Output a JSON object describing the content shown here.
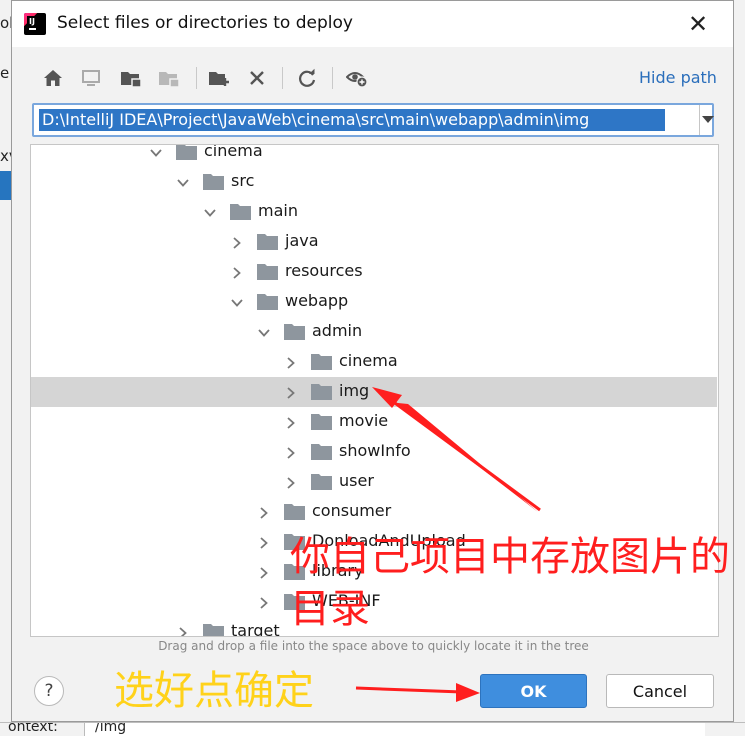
{
  "background": {
    "left_fragments": [
      "ol",
      "e",
      "xv"
    ],
    "bottom_left_text": "ontext:",
    "bottom_field_value": "/img"
  },
  "dialog": {
    "title": "Select files or directories to deploy",
    "app_icon": "intellij-idea-icon",
    "close_label": "✕"
  },
  "toolbar": {
    "icons": [
      "home-icon",
      "desktop-icon",
      "project-folder-icon",
      "module-folder-icon",
      "new-folder-icon",
      "delete-icon",
      "refresh-icon",
      "show-hidden-icon"
    ],
    "hide_path_label": "Hide path"
  },
  "path": {
    "value": "D:\\IntelliJ IDEA\\Project\\JavaWeb\\cinema\\src\\main\\webapp\\admin\\img"
  },
  "tree": {
    "rows": [
      {
        "label": "cinema",
        "depth": 0,
        "expanded": true
      },
      {
        "label": "src",
        "depth": 1,
        "expanded": true
      },
      {
        "label": "main",
        "depth": 2,
        "expanded": true
      },
      {
        "label": "java",
        "depth": 3,
        "expanded": false
      },
      {
        "label": "resources",
        "depth": 3,
        "expanded": false
      },
      {
        "label": "webapp",
        "depth": 3,
        "expanded": true
      },
      {
        "label": "admin",
        "depth": 4,
        "expanded": true
      },
      {
        "label": "cinema",
        "depth": 5,
        "expanded": false
      },
      {
        "label": "img",
        "depth": 5,
        "expanded": false,
        "selected": true
      },
      {
        "label": "movie",
        "depth": 5,
        "expanded": false
      },
      {
        "label": "showInfo",
        "depth": 5,
        "expanded": false
      },
      {
        "label": "user",
        "depth": 5,
        "expanded": false
      },
      {
        "label": "consumer",
        "depth": 4,
        "expanded": false
      },
      {
        "label": "DonloadAndUpload",
        "depth": 4,
        "expanded": false
      },
      {
        "label": "library",
        "depth": 4,
        "expanded": false
      },
      {
        "label": "WEB-INF",
        "depth": 4,
        "expanded": false
      },
      {
        "label": "target",
        "depth": 1,
        "expanded": false
      }
    ]
  },
  "hint": "Drag and drop a file into the space above to quickly locate it in the tree",
  "buttons": {
    "help_label": "?",
    "ok_label": "OK",
    "cancel_label": "Cancel"
  },
  "annotations": {
    "red_text": "你自己项目中存放图片的目录",
    "yellow_text": "选好点确定",
    "red_color": "#ff1e1e",
    "yellow_color": "#ffd21a"
  },
  "colors": {
    "accent": "#3f8ede",
    "selection": "#2e76c6",
    "link": "#2a6ebb",
    "folder": "#8e969e"
  }
}
